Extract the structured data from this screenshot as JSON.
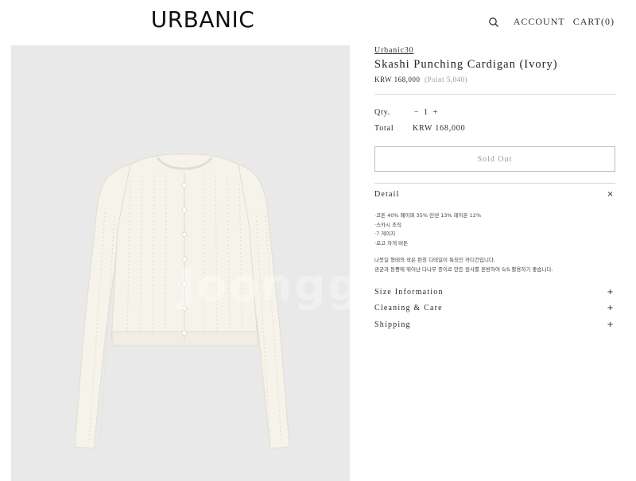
{
  "header": {
    "logo": "URBANIC",
    "account_label": "ACCOUNT",
    "cart_label": "CART(0)",
    "search_icon": "search-icon"
  },
  "photo": {
    "watermark": "Joonggonara"
  },
  "product": {
    "brand": "Urbanic30",
    "title": "Skashi Punching Cardigan (Ivory)",
    "price": "KRW 168,000",
    "point": "(Point 5,040)",
    "qty_label": "Qty.",
    "qty_minus": "−",
    "qty_value": "1",
    "qty_plus": "+",
    "total_label": "Total",
    "total_value": "KRW 168,000",
    "soldout_label": "Sold Out"
  },
  "sections": {
    "detail": {
      "label": "Detail",
      "toggle": "×",
      "specs": [
        "·코튼 40% 폐이퍼 35% 린넨 13% 레이온 12%",
        "·스카시 조직",
        "·7 게이지",
        "·로고 자개 버튼"
      ],
      "description": [
        "나붓일 형태의 작은 펀칭 디테일이 특징인 카디건입니다.",
        "광균과 등뽕에 뛰어난 다나무 종이로 만든 원사를 혼방하여 S/S 활용하기 좋습니다."
      ]
    },
    "size": {
      "label": "Size Information",
      "toggle": "+"
    },
    "care": {
      "label": "Cleaning & Care",
      "toggle": "+"
    },
    "shipping": {
      "label": "Shipping",
      "toggle": "+"
    }
  },
  "colors": {
    "photo_bg": "#e9e9ea",
    "garment": "#f6f3ea",
    "button_border": "#bdbdbd"
  }
}
